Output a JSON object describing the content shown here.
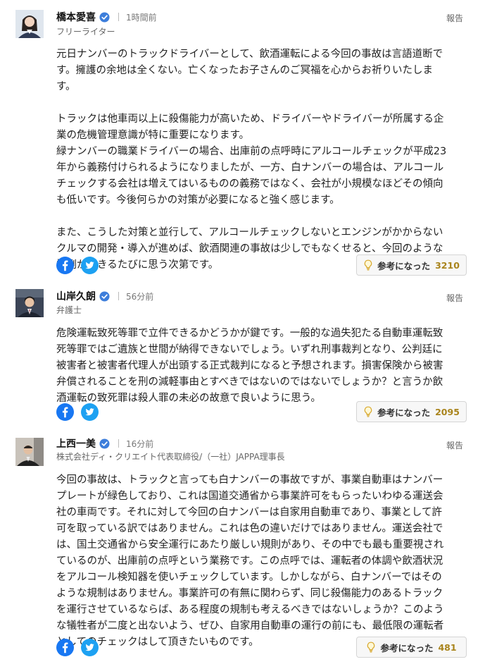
{
  "comments": [
    {
      "author": "橋本愛喜",
      "time": "1時間前",
      "role": "フリーライター",
      "report": "報告",
      "paragraphs": [
        "元日ナンバーのトラックドライバーとして、飲酒運転による今回の事故は言語道断で\nす。擁護の余地は全くない。亡くなったお子さんのご冥福を心からお祈りいたしま\nす。",
        "トラックは他車両以上に殺傷能力が高いため、ドライバーやドライバーが所属する企\n業の危機管理意識が特に重要になります。\n緑ナンバーの職業ドライバーの場合、出庫前の点呼時にアルコールチェックが平成23\n年から義務付けられるようになりましたが、一方、白ナンバーの場合は、アルコール\nチェックする会社は増えてはいるものの義務ではなく、会社が小規模なほどその傾向\nも低いです。今後何らかの対策が必要になると強く感じます。",
        "また、こうした対策と並行して、アルコールチェックしないとエンジンがかからない\nクルマの開発・導入が進めば、飲酒関連の事故は少しでもなくせると、今回のような\n惨劇が起きるたびに思う次第です。"
      ],
      "helpful_label": "参考になった",
      "helpful_count": "3210"
    },
    {
      "author": "山岸久朗",
      "time": "56分前",
      "role": "弁護士",
      "report": "報告",
      "paragraphs": [
        "危険運転致死等罪で立件できるかどうかが鍵です。一般的な過失犯たる自動車運転致\n死等罪ではご遺族と世間が納得できないでしょう。いずれ刑事裁判となり、公判廷に\n被害者と被害者代理人が出頭する正式裁判になると予想されます。損害保険から被害\n弁償されることを刑の減軽事由とすべきではないのではないでしょうか？と言うか飲\n酒運転の致死罪は殺人罪の未必の故意で良いように思う。"
      ],
      "helpful_label": "参考になった",
      "helpful_count": "2095"
    },
    {
      "author": "上西一美",
      "time": "16分前",
      "role": "株式会社ディ・クリエイト代表取締役/（一社）JAPPA理事長",
      "report": "報告",
      "paragraphs": [
        "今回の事故は、トラックと言っても白ナンバーの事故ですが、事業自動車はナンバー\nプレートが緑色しており、これは国道交通省から事業許可をもらったいわゆる運送会\n社の車両です。それに対して今回の白ナンバーは自家用自動車であり、事業として許\n可を取っている訳ではありません。これは色の違いだけではありません。運送会社で\nは、国土交通省から安全運行にあたり厳しい規則があり、その中でも最も重要視され\nているのが、出庫前の点呼という業務です。この点呼では、運転者の体調や飲酒状況\nをアルコール検知器を使いチェックしています。しかしながら、白ナンバーではその\nような規制はありません。事業許可の有無に関わらず、同じ殺傷能力のあるトラック\nを運行させているならば、ある程度の規制も考えるべきではないしょうか？このよう\nな犠牲者が二度と出ないよう、ぜひ、自家用自動車の運行の前にも、最低限の運転者\nとしてのチェックはして頂きたいものです。"
      ],
      "helpful_label": "参考になった",
      "helpful_count": "481"
    }
  ],
  "icons": {
    "verified": "verified-check-icon",
    "facebook": "facebook-icon",
    "twitter": "twitter-icon",
    "helpful": "lightbulb-icon"
  },
  "colors": {
    "facebook": "#1877f2",
    "twitter": "#1da1f2",
    "verified": "#3d7edb",
    "helpful_count": "#a9841c"
  }
}
